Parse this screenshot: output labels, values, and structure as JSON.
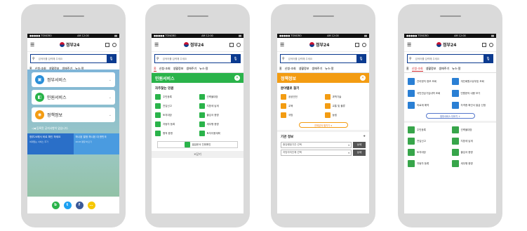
{
  "status": {
    "carrier": "●●●●● TONGRO",
    "time": "AM 12:00",
    "battery": "▮▮"
  },
  "header": {
    "logo": "정부24",
    "search_placeholder": "검색어를 입력해 주세요"
  },
  "tabs": [
    "홈",
    "신청·조회",
    "생활정보",
    "생애주기",
    "뉴스·알"
  ],
  "screen1": {
    "menu": [
      {
        "label": "정부서비스",
        "color": "#2a8fd8",
        "icon": "▣"
      },
      {
        "label": "민원서비스",
        "color": "#2ab34a",
        "icon": "◧"
      },
      {
        "label": "정책정보",
        "color": "#f39c12",
        "icon": "◉"
      }
    ],
    "notice": "◁◀ 등록된 공지사항이 없습니다.",
    "banner_left": {
      "title": "정부24에서 비로 확인 하세요",
      "sub": "여대없는 서비스 주가"
    },
    "banner_right": {
      "title": "하나된 열정 하나된 대 한민국",
      "sub": "2018 평창 바오기"
    },
    "social": [
      {
        "label": "b",
        "color": "#2ab34a"
      },
      {
        "label": "t",
        "color": "#1da1f2"
      },
      {
        "label": "f",
        "color": "#3b5998"
      },
      {
        "label": "…",
        "color": "#f6c700"
      }
    ]
  },
  "screen2": {
    "title": "민원서비스",
    "subtitle": "자주찾는 민원",
    "items": [
      "주민등록",
      "건축물대장",
      "전입신고",
      "지방세 납세",
      "토지대장",
      "출입국 증명",
      "자동차 등록",
      "세무행 증명",
      "병적 증명",
      "토지이용계획"
    ],
    "wide_button": "발급문서 진위확인",
    "close": "✕닫기"
  },
  "screen3": {
    "title": "정책정보",
    "subtitle": "분야별로 찾기",
    "items": [
      "공공안전",
      "과학기술",
      "교육",
      "교통 및 물류",
      "국방",
      "농림"
    ],
    "pill": "전체분야 펼치기 ▾",
    "section": "기관 정보",
    "plus": "+",
    "select1": "중앙행정기관 선택",
    "select2": "지방자치단체 선택",
    "detail": "상세"
  },
  "screen4": {
    "top_items": [
      "관리현직 정보 조회",
      "개인회원고유부호 조회",
      "국민연금기입내역 조회",
      "민원문의 내용 보기",
      "의료재 예약",
      "자격증 확인서 발급 신청"
    ],
    "pill": "정부서비스 더보기 +",
    "items": [
      "주민등록",
      "건축물대장",
      "전입신고",
      "지방세 납세",
      "토지대장",
      "출입국 증명",
      "자동차 등록",
      "세무행 증명"
    ]
  }
}
